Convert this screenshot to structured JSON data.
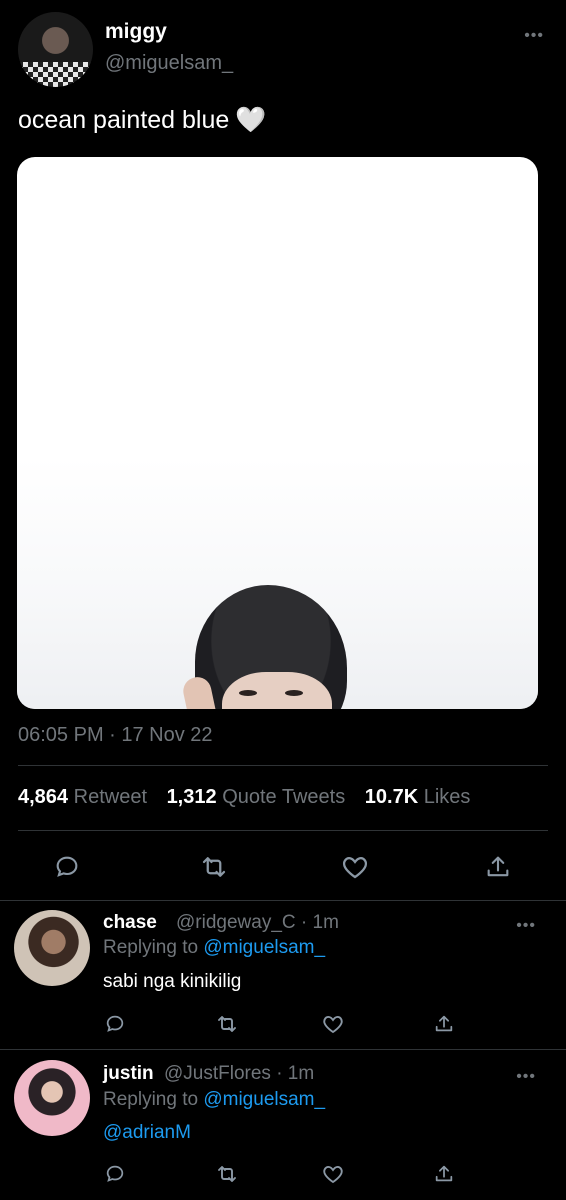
{
  "tweet": {
    "display_name": "miggy",
    "handle": "@miguelsam_",
    "text": "ocean painted blue",
    "emoji": "🤍",
    "timestamp": "06:05 PM · 17 Nov 22",
    "more_icon": "ellipsis-icon",
    "stats": {
      "retweets": "4,864",
      "retweets_label": "Retweet",
      "quotes": "1,312",
      "quotes_label": "Quote Tweets",
      "likes": "10.7K",
      "likes_label": "Likes"
    },
    "actions": [
      "reply-icon",
      "retweet-icon",
      "like-icon",
      "share-icon"
    ]
  },
  "replies": [
    {
      "display_name": "chase",
      "handle_time": "@ridgeway_C · 1m",
      "replying_prefix": "Replying to",
      "replying_to": "@miguelsam_",
      "text": "sabi nga kinikilig"
    },
    {
      "display_name": "justin",
      "handle_time": "@JustFlores · 1m",
      "replying_prefix": "Replying to",
      "replying_to": "@miguelsam_",
      "text": "@adrianM"
    }
  ],
  "colors": {
    "background": "#000000",
    "text_primary": "#ffffff",
    "text_secondary": "#71767b",
    "link": "#1d9bf0",
    "divider": "#2f3336"
  }
}
